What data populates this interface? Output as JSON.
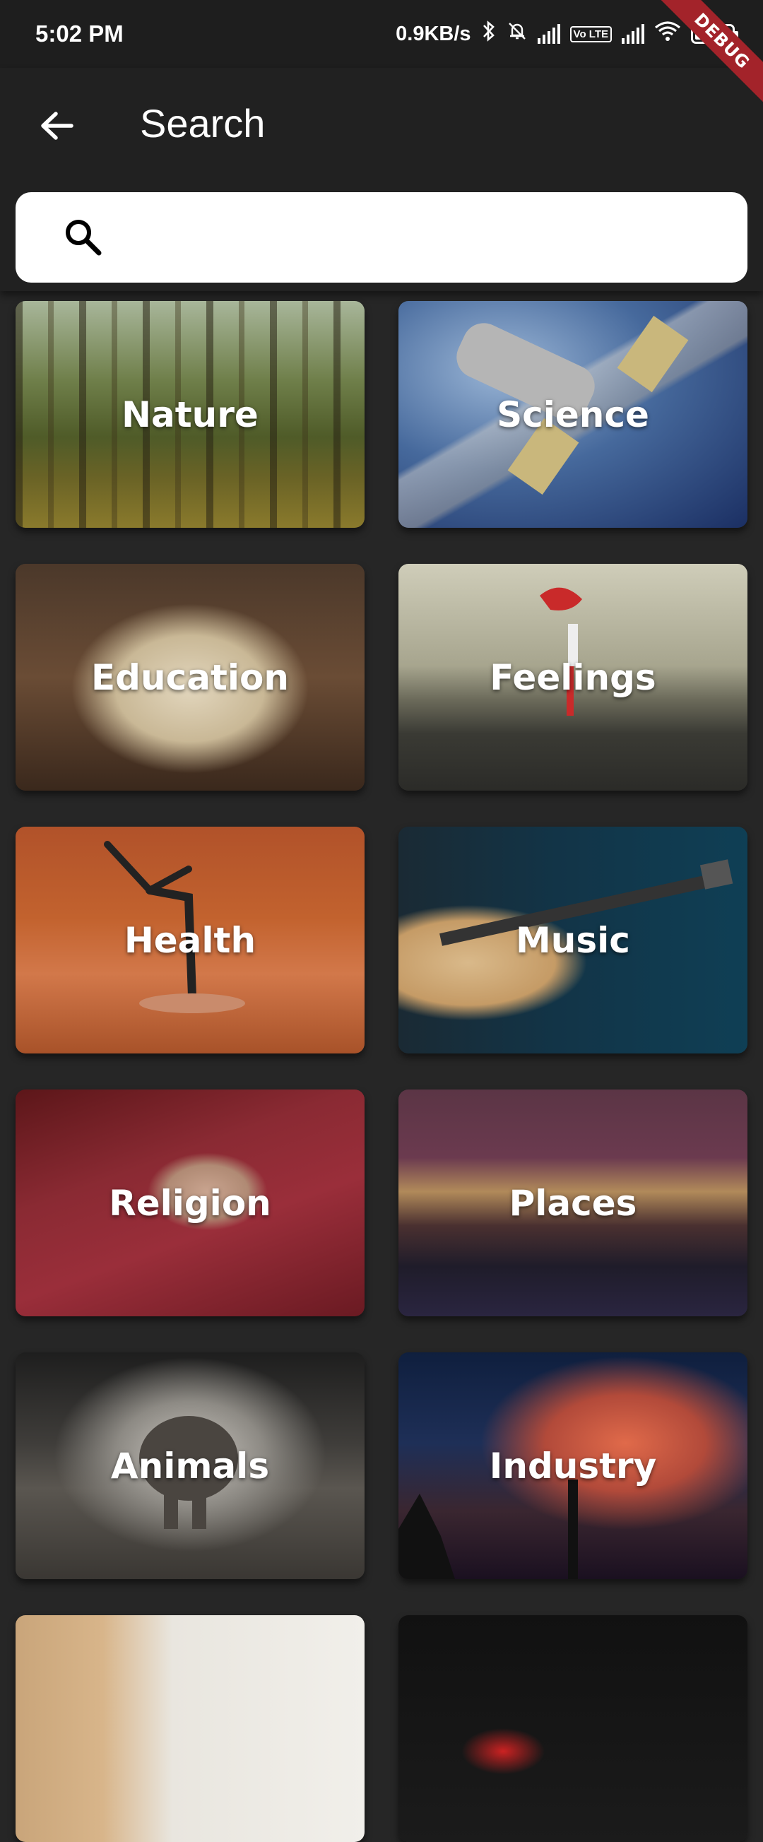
{
  "status_bar": {
    "time": "5:02 PM",
    "net_speed": "0.9KB/s",
    "volte": "Vo LTE"
  },
  "debug_banner": "DEBUG",
  "app_bar": {
    "title": "Search",
    "back_icon": "arrow-left-icon"
  },
  "search": {
    "icon": "search-icon",
    "value": "",
    "placeholder": ""
  },
  "categories": [
    {
      "label": "Nature"
    },
    {
      "label": "Science"
    },
    {
      "label": "Education"
    },
    {
      "label": "Feelings"
    },
    {
      "label": "Health"
    },
    {
      "label": "Music"
    },
    {
      "label": "Religion"
    },
    {
      "label": "Places"
    },
    {
      "label": "Animals"
    },
    {
      "label": "Industry"
    },
    {
      "label": ""
    },
    {
      "label": ""
    }
  ],
  "colors": {
    "background": "#262626",
    "app_bar": "#212121",
    "status_bar": "#1e1e1e",
    "debug_ribbon": "#a3232a"
  }
}
